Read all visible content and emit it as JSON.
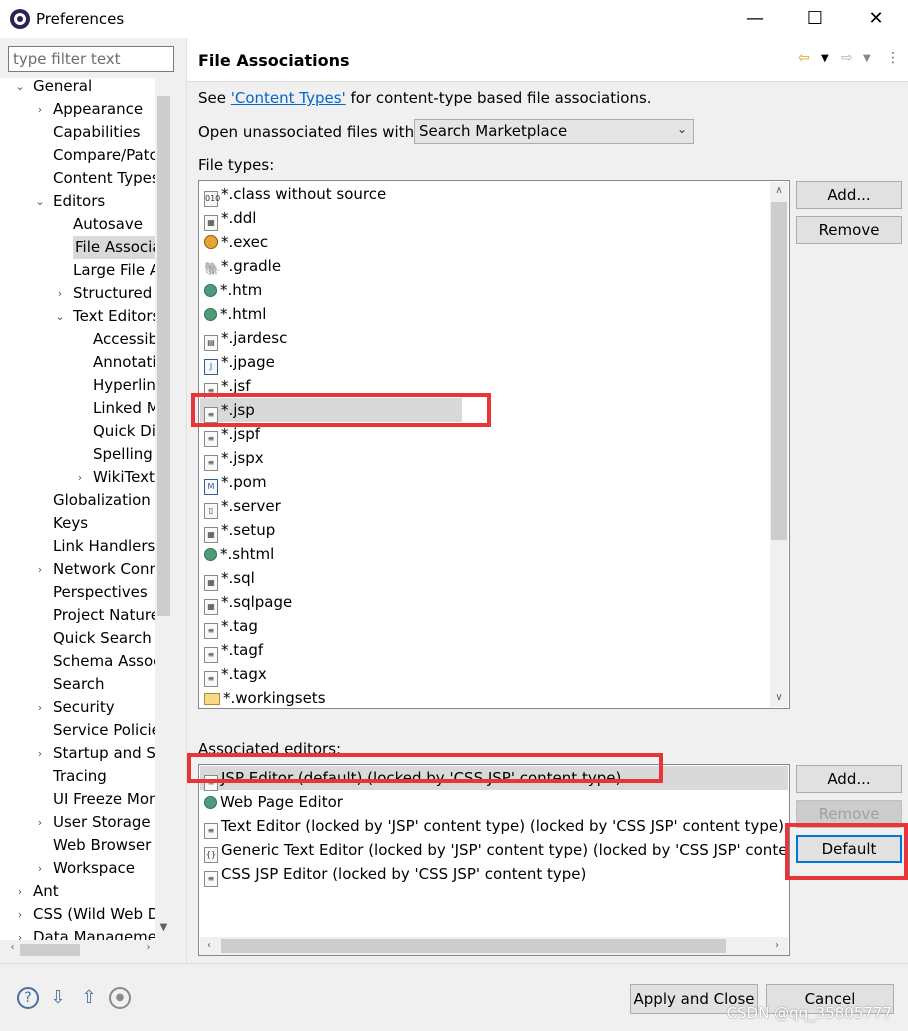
{
  "window": {
    "title": "Preferences",
    "minimize_glyph": "—",
    "maximize_glyph": "☐",
    "close_glyph": "✕"
  },
  "filter": {
    "placeholder": "type filter text"
  },
  "tree": [
    {
      "label": "General",
      "depth": 0,
      "twisty": "⌄"
    },
    {
      "label": "Appearance",
      "depth": 1,
      "twisty": "›"
    },
    {
      "label": "Capabilities",
      "depth": 1,
      "twisty": ""
    },
    {
      "label": "Compare/Patch",
      "depth": 1,
      "twisty": ""
    },
    {
      "label": "Content Types",
      "depth": 1,
      "twisty": ""
    },
    {
      "label": "Editors",
      "depth": 1,
      "twisty": "⌄"
    },
    {
      "label": "Autosave",
      "depth": 2,
      "twisty": ""
    },
    {
      "label": "File Associations",
      "depth": 2,
      "twisty": "",
      "selected": true
    },
    {
      "label": "Large File Associations",
      "depth": 2,
      "twisty": ""
    },
    {
      "label": "Structured Text Editors",
      "depth": 2,
      "twisty": "›"
    },
    {
      "label": "Text Editors",
      "depth": 2,
      "twisty": "⌄"
    },
    {
      "label": "Accessibility",
      "depth": 3,
      "twisty": ""
    },
    {
      "label": "Annotations",
      "depth": 3,
      "twisty": ""
    },
    {
      "label": "Hyperlinking",
      "depth": 3,
      "twisty": ""
    },
    {
      "label": "Linked Mode",
      "depth": 3,
      "twisty": ""
    },
    {
      "label": "Quick Diff",
      "depth": 3,
      "twisty": ""
    },
    {
      "label": "Spelling",
      "depth": 3,
      "twisty": ""
    },
    {
      "label": "WikiText",
      "depth": 3,
      "twisty": "›"
    },
    {
      "label": "Globalization",
      "depth": 1,
      "twisty": ""
    },
    {
      "label": "Keys",
      "depth": 1,
      "twisty": ""
    },
    {
      "label": "Link Handlers",
      "depth": 1,
      "twisty": ""
    },
    {
      "label": "Network Connections",
      "depth": 1,
      "twisty": "›"
    },
    {
      "label": "Perspectives",
      "depth": 1,
      "twisty": ""
    },
    {
      "label": "Project Natures",
      "depth": 1,
      "twisty": ""
    },
    {
      "label": "Quick Search",
      "depth": 1,
      "twisty": ""
    },
    {
      "label": "Schema Associations",
      "depth": 1,
      "twisty": ""
    },
    {
      "label": "Search",
      "depth": 1,
      "twisty": ""
    },
    {
      "label": "Security",
      "depth": 1,
      "twisty": "›"
    },
    {
      "label": "Service Policies",
      "depth": 1,
      "twisty": ""
    },
    {
      "label": "Startup and Shutdown",
      "depth": 1,
      "twisty": "›"
    },
    {
      "label": "Tracing",
      "depth": 1,
      "twisty": ""
    },
    {
      "label": "UI Freeze Monitoring",
      "depth": 1,
      "twisty": ""
    },
    {
      "label": "User Storage",
      "depth": 1,
      "twisty": "›"
    },
    {
      "label": "Web Browser",
      "depth": 1,
      "twisty": ""
    },
    {
      "label": "Workspace",
      "depth": 1,
      "twisty": "›"
    },
    {
      "label": "Ant",
      "depth": 0,
      "twisty": "›"
    },
    {
      "label": "CSS (Wild Web Developer)",
      "depth": 0,
      "twisty": "›"
    },
    {
      "label": "Data Management",
      "depth": 0,
      "twisty": "›"
    }
  ],
  "page": {
    "title": "File Associations",
    "see_prefix": "See ",
    "see_link": "'Content Types'",
    "see_suffix": " for content-type based file associations.",
    "open_unassociated_label": "Open unassociated files with:",
    "open_unassociated_value": "Search Marketplace",
    "file_types_label": "File types:",
    "associated_editors_label": "Associated editors:"
  },
  "file_types": [
    {
      "label": "*.class without source",
      "icon": "class-file-icon",
      "glyph": "010",
      "cls": ""
    },
    {
      "label": "*.ddl",
      "icon": "ddl-file-icon",
      "glyph": "▦",
      "cls": ""
    },
    {
      "label": "*.exec",
      "icon": "exec-gear-icon",
      "glyph": "",
      "cls": "gear"
    },
    {
      "label": "*.gradle",
      "icon": "gradle-elephant-icon",
      "glyph": "🐘",
      "cls": "grad"
    },
    {
      "label": "*.htm",
      "icon": "html-globe-icon",
      "glyph": "",
      "cls": "globe"
    },
    {
      "label": "*.html",
      "icon": "html-globe-icon",
      "glyph": "",
      "cls": "globe"
    },
    {
      "label": "*.jardesc",
      "icon": "jardesc-file-icon",
      "glyph": "▤",
      "cls": ""
    },
    {
      "label": "*.jpage",
      "icon": "jpage-file-icon",
      "glyph": "J",
      "cls": "java"
    },
    {
      "label": "*.jsf",
      "icon": "text-file-icon",
      "glyph": "≡",
      "cls": ""
    },
    {
      "label": "*.jsp",
      "icon": "text-file-icon",
      "glyph": "≡",
      "cls": "",
      "selected": true
    },
    {
      "label": "*.jspf",
      "icon": "text-file-icon",
      "glyph": "≡",
      "cls": ""
    },
    {
      "label": "*.jspx",
      "icon": "text-file-icon",
      "glyph": "≡",
      "cls": ""
    },
    {
      "label": "*.pom",
      "icon": "maven-pom-icon",
      "glyph": "M",
      "cls": "java"
    },
    {
      "label": "*.server",
      "icon": "server-file-icon",
      "glyph": "▯",
      "cls": ""
    },
    {
      "label": "*.setup",
      "icon": "setup-file-icon",
      "glyph": "▦",
      "cls": ""
    },
    {
      "label": "*.shtml",
      "icon": "html-globe-icon",
      "glyph": "",
      "cls": "globe"
    },
    {
      "label": "*.sql",
      "icon": "sql-file-icon",
      "glyph": "▦",
      "cls": ""
    },
    {
      "label": "*.sqlpage",
      "icon": "sql-file-icon",
      "glyph": "▦",
      "cls": ""
    },
    {
      "label": "*.tag",
      "icon": "text-file-icon",
      "glyph": "≡",
      "cls": ""
    },
    {
      "label": "*.tagf",
      "icon": "text-file-icon",
      "glyph": "≡",
      "cls": ""
    },
    {
      "label": "*.tagx",
      "icon": "text-file-icon",
      "glyph": "≡",
      "cls": ""
    },
    {
      "label": "*.workingsets",
      "icon": "folder-icon",
      "glyph": "",
      "cls": "folder"
    }
  ],
  "editors": [
    {
      "label": "JSP Editor (default) (locked by 'CSS JSP' content type)",
      "icon": "text-file-icon",
      "glyph": "≡",
      "cls": "",
      "selected": true
    },
    {
      "label": "Web Page Editor",
      "icon": "web-page-editor-icon",
      "glyph": "",
      "cls": "globe"
    },
    {
      "label": "Text Editor (locked by 'JSP' content type) (locked by 'CSS JSP' content type)",
      "icon": "text-file-icon",
      "glyph": "≡",
      "cls": ""
    },
    {
      "label": "Generic Text Editor (locked by 'JSP' content type) (locked by 'CSS JSP' content type)",
      "icon": "generic-editor-icon",
      "glyph": "{}",
      "cls": ""
    },
    {
      "label": "CSS JSP Editor (locked by 'CSS JSP' content type)",
      "icon": "text-file-icon",
      "glyph": "≡",
      "cls": ""
    }
  ],
  "buttons": {
    "file_add": "Add...",
    "file_remove": "Remove",
    "editor_add": "Add...",
    "editor_remove": "Remove",
    "editor_default": "Default",
    "apply_close": "Apply and Close",
    "cancel": "Cancel"
  },
  "watermark": "CSDN @qq_35805777",
  "colors": {
    "annotation": "#e8353a",
    "link": "#0066cc",
    "focus": "#0078d7"
  }
}
